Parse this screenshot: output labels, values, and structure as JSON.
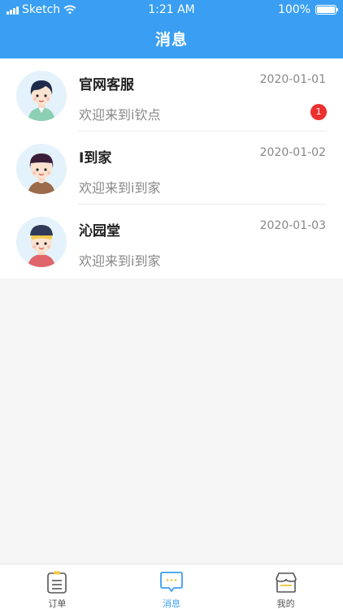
{
  "status_bar": {
    "carrier": "Sketch",
    "time": "1:21 AM",
    "battery": "100%"
  },
  "header": {
    "title": "消息"
  },
  "messages": [
    {
      "name": "官网客服",
      "date": "2020-01-01",
      "preview": "欢迎来到i钦点",
      "unread": "1",
      "avatar_icon": "girl-avatar-icon"
    },
    {
      "name": "I到家",
      "date": "2020-01-02",
      "preview": "欢迎来到i到家",
      "unread": "",
      "avatar_icon": "boy-avatar-icon"
    },
    {
      "name": "沁园堂",
      "date": "2020-01-03",
      "preview": "欢迎来到i到家",
      "unread": "",
      "avatar_icon": "cap-boy-avatar-icon"
    }
  ],
  "tabbar": {
    "tabs": [
      {
        "label": "订单",
        "icon": "order-list-icon",
        "active": false
      },
      {
        "label": "消息",
        "icon": "message-bubble-icon",
        "active": true
      },
      {
        "label": "我的",
        "icon": "store-icon",
        "active": false
      }
    ]
  },
  "colors": {
    "primary": "#3a9ff2",
    "badge": "#ec2f2f",
    "background": "#f6f6f6"
  }
}
